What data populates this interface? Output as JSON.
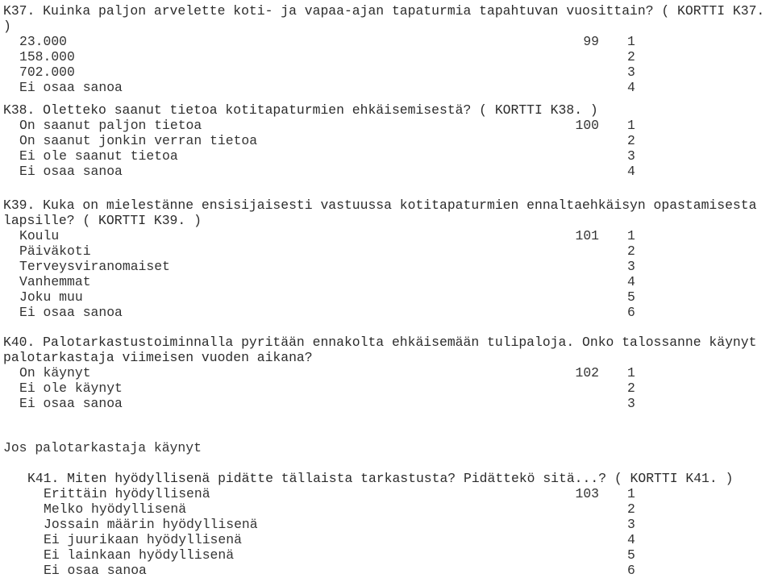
{
  "questions": [
    {
      "id": "K37",
      "text_lines": [
        "K37. Kuinka paljon arvelette koti- ja vapaa-ajan tapaturmia tapahtuvan vuosittain? ( KORTTI K37.",
        ")"
      ],
      "variable": "99",
      "options": [
        {
          "label": "23.000",
          "code": "1"
        },
        {
          "label": "158.000",
          "code": "2"
        },
        {
          "label": "702.000",
          "code": "3"
        },
        {
          "label": "Ei osaa sanoa",
          "code": "4"
        }
      ]
    },
    {
      "id": "K38",
      "text_lines": [
        "K38. Oletteko saanut tietoa kotitapaturmien ehkäisemisestä? ( KORTTI K38. )"
      ],
      "variable": "100",
      "options": [
        {
          "label": "On saanut paljon tietoa",
          "code": "1"
        },
        {
          "label": "On saanut jonkin verran tietoa",
          "code": "2"
        },
        {
          "label": "Ei ole saanut tietoa",
          "code": "3"
        },
        {
          "label": "Ei osaa sanoa",
          "code": "4"
        }
      ]
    },
    {
      "id": "K39",
      "text_lines": [
        "K39. Kuka on mielestänne ensisijaisesti vastuussa kotitapaturmien ennaltaehkäisyn opastamisesta",
        "lapsille? ( KORTTI K39. )"
      ],
      "variable": "101",
      "options": [
        {
          "label": "Koulu",
          "code": "1"
        },
        {
          "label": "Päiväkoti",
          "code": "2"
        },
        {
          "label": "Terveysviranomaiset",
          "code": "3"
        },
        {
          "label": "Vanhemmat",
          "code": "4"
        },
        {
          "label": "Joku muu",
          "code": "5"
        },
        {
          "label": "Ei osaa sanoa",
          "code": "6"
        }
      ]
    },
    {
      "id": "K40",
      "text_lines": [
        "K40. Palotarkastustoiminnalla pyritään ennakolta ehkäisemään tulipaloja. Onko talossanne käynyt",
        "palotarkastaja viimeisen vuoden aikana?"
      ],
      "variable": "102",
      "options": [
        {
          "label": "On käynyt",
          "code": "1"
        },
        {
          "label": "Ei ole käynyt",
          "code": "2"
        },
        {
          "label": "Ei osaa sanoa",
          "code": "3"
        }
      ]
    }
  ],
  "filter_note": "Jos palotarkastaja käynyt",
  "sub_question": {
    "id": "K41",
    "text_lines": [
      "K41. Miten hyödyllisenä pidätte tällaista tarkastusta? Pidättekö sitä...? ( KORTTI K41. )"
    ],
    "variable": "103",
    "options": [
      {
        "label": "Erittäin hyödyllisenä",
        "code": "1"
      },
      {
        "label": "Melko hyödyllisenä",
        "code": "2"
      },
      {
        "label": "Jossain määrin hyödyllisenä",
        "code": "3"
      },
      {
        "label": "Ei juurikaan hyödyllisenä",
        "code": "4"
      },
      {
        "label": "Ei lainkaan hyödyllisenä",
        "code": "5"
      },
      {
        "label": "Ei osaa sanoa",
        "code": "6"
      }
    ]
  }
}
